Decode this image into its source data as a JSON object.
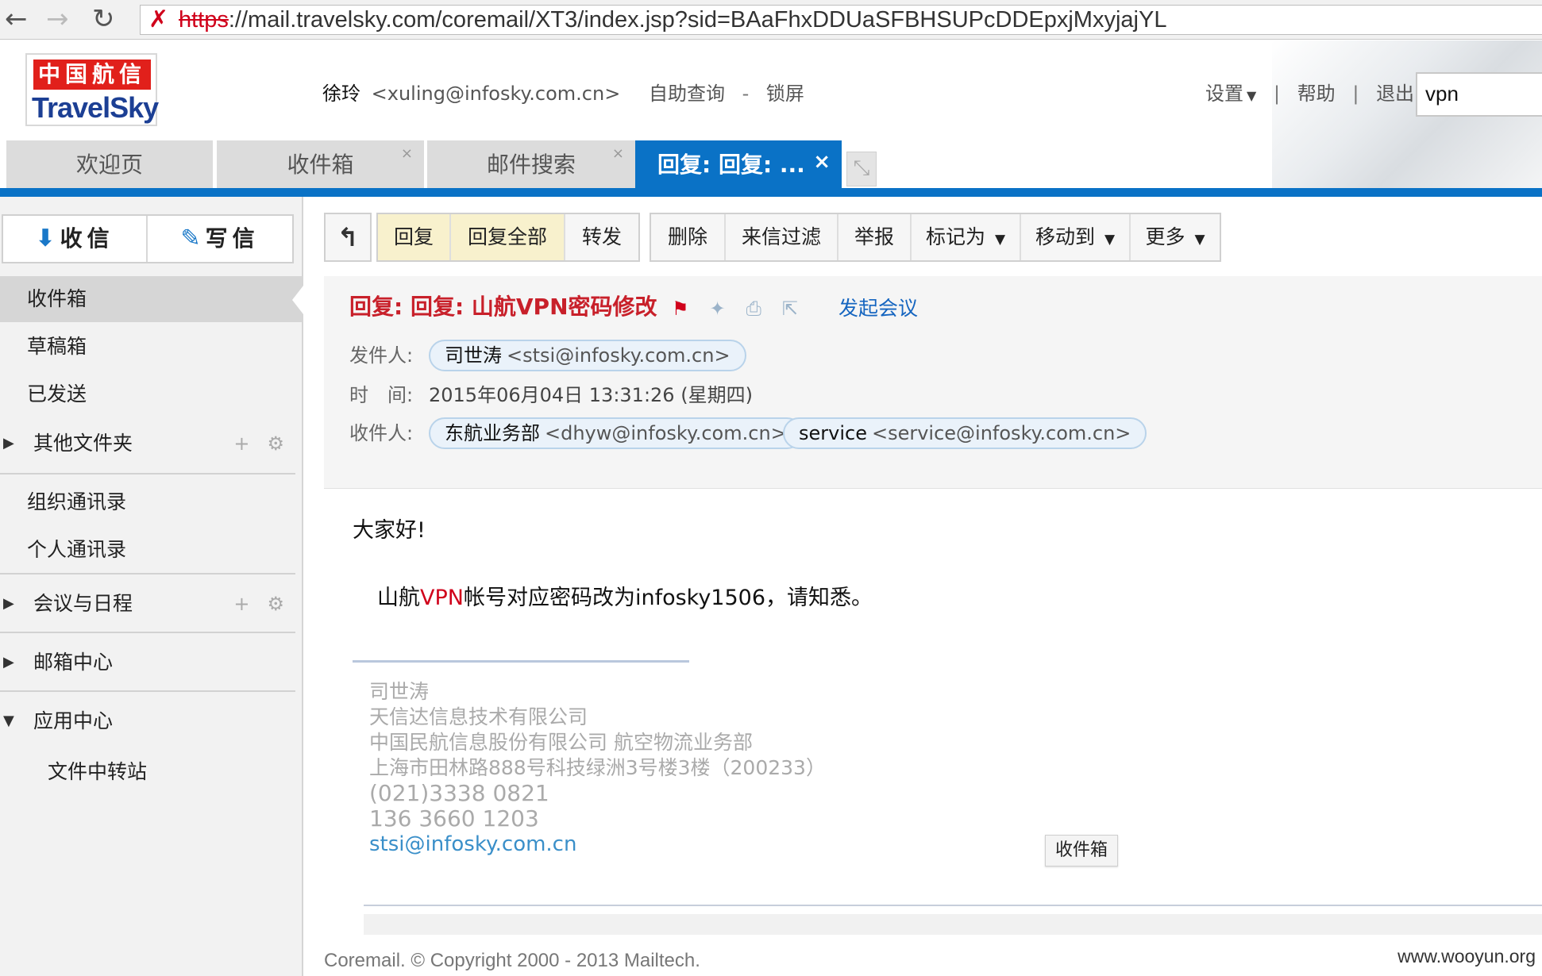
{
  "browser": {
    "back_icon": "←",
    "forward_icon": "→",
    "reload_icon": "↻",
    "insecure_icon": "✗",
    "url_protocol": "https",
    "url_rest": "://mail.travelsky.com/coremail/XT3/index.jsp?sid=BAaFhxDDUaSFBHSUPcDDEpxjMxyjajYL"
  },
  "header": {
    "logo_cn": "中国航信",
    "logo_en": "TravelSky",
    "user_name": "徐玲",
    "user_email": "<xuling@infosky.com.cn>",
    "self_query": "自助查询",
    "dash": "-",
    "lock_screen": "锁屏",
    "settings": "设置",
    "help": "帮助",
    "logout": "退出",
    "separator": "|",
    "search_value": "vpn"
  },
  "tabs": {
    "welcome": "欢迎页",
    "inbox": "收件箱",
    "search": "邮件搜索",
    "active": "回复: 回复: ...",
    "close_glyph": "×"
  },
  "sidebar": {
    "receive_label": "收信",
    "write_label": "写信",
    "inbox": "收件箱",
    "drafts": "草稿箱",
    "sent": "已发送",
    "other_folders": "其他文件夹",
    "org_contacts": "组织通讯录",
    "personal_contacts": "个人通讯录",
    "meetings": "会议与日程",
    "mailbox_center": "邮箱中心",
    "app_center": "应用中心",
    "file_transfer": "文件中转站"
  },
  "toolbar": {
    "back_icon": "↰",
    "reply": "回复",
    "reply_all": "回复全部",
    "forward": "转发",
    "delete": "删除",
    "filter": "来信过滤",
    "report": "举报",
    "mark_as": "标记为",
    "move_to": "移动到",
    "more": "更多"
  },
  "mail": {
    "subject": "回复: 回复: 山航VPN密码修改",
    "start_meeting": "发起会议",
    "from_label": "发件人:",
    "from_name": "司世涛",
    "from_addr": "<stsi@infosky.com.cn>",
    "time_label": "时　间:",
    "time_value": "2015年06月04日 13:31:26 (星期四)",
    "to_label": "收件人:",
    "to1_name": "东航业务部",
    "to1_addr": "<dhyw@infosky.com.cn>",
    "to2_name": "service",
    "to2_addr": "<service@infosky.com.cn>",
    "greeting": "大家好!",
    "body_before": "山航",
    "body_highlight": "VPN",
    "body_after": "帐号对应密码改为infosky1506，请知悉。",
    "sig_name": "司世涛",
    "sig_company1": "天信达信息技术有限公司",
    "sig_company2": "中国民航信息股份有限公司 航空物流业务部",
    "sig_address": "上海市田林路888号科技绿洲3号楼3楼（200233）",
    "sig_phone": "(021)3338 0821",
    "sig_mobile": "136 3660 1203",
    "sig_email": "stsi@infosky.com.cn",
    "floating_inbox": "收件箱"
  },
  "footer": {
    "copyright": "Coremail. © Copyright 2000 - 2013 Mailtech.",
    "watermark": "www.wooyun.org"
  },
  "colors": {
    "brand_blue": "#0a72c6",
    "subject_red": "#c8202a",
    "link_blue": "#1565c0",
    "highlight_yellow": "#f8f1cd"
  }
}
